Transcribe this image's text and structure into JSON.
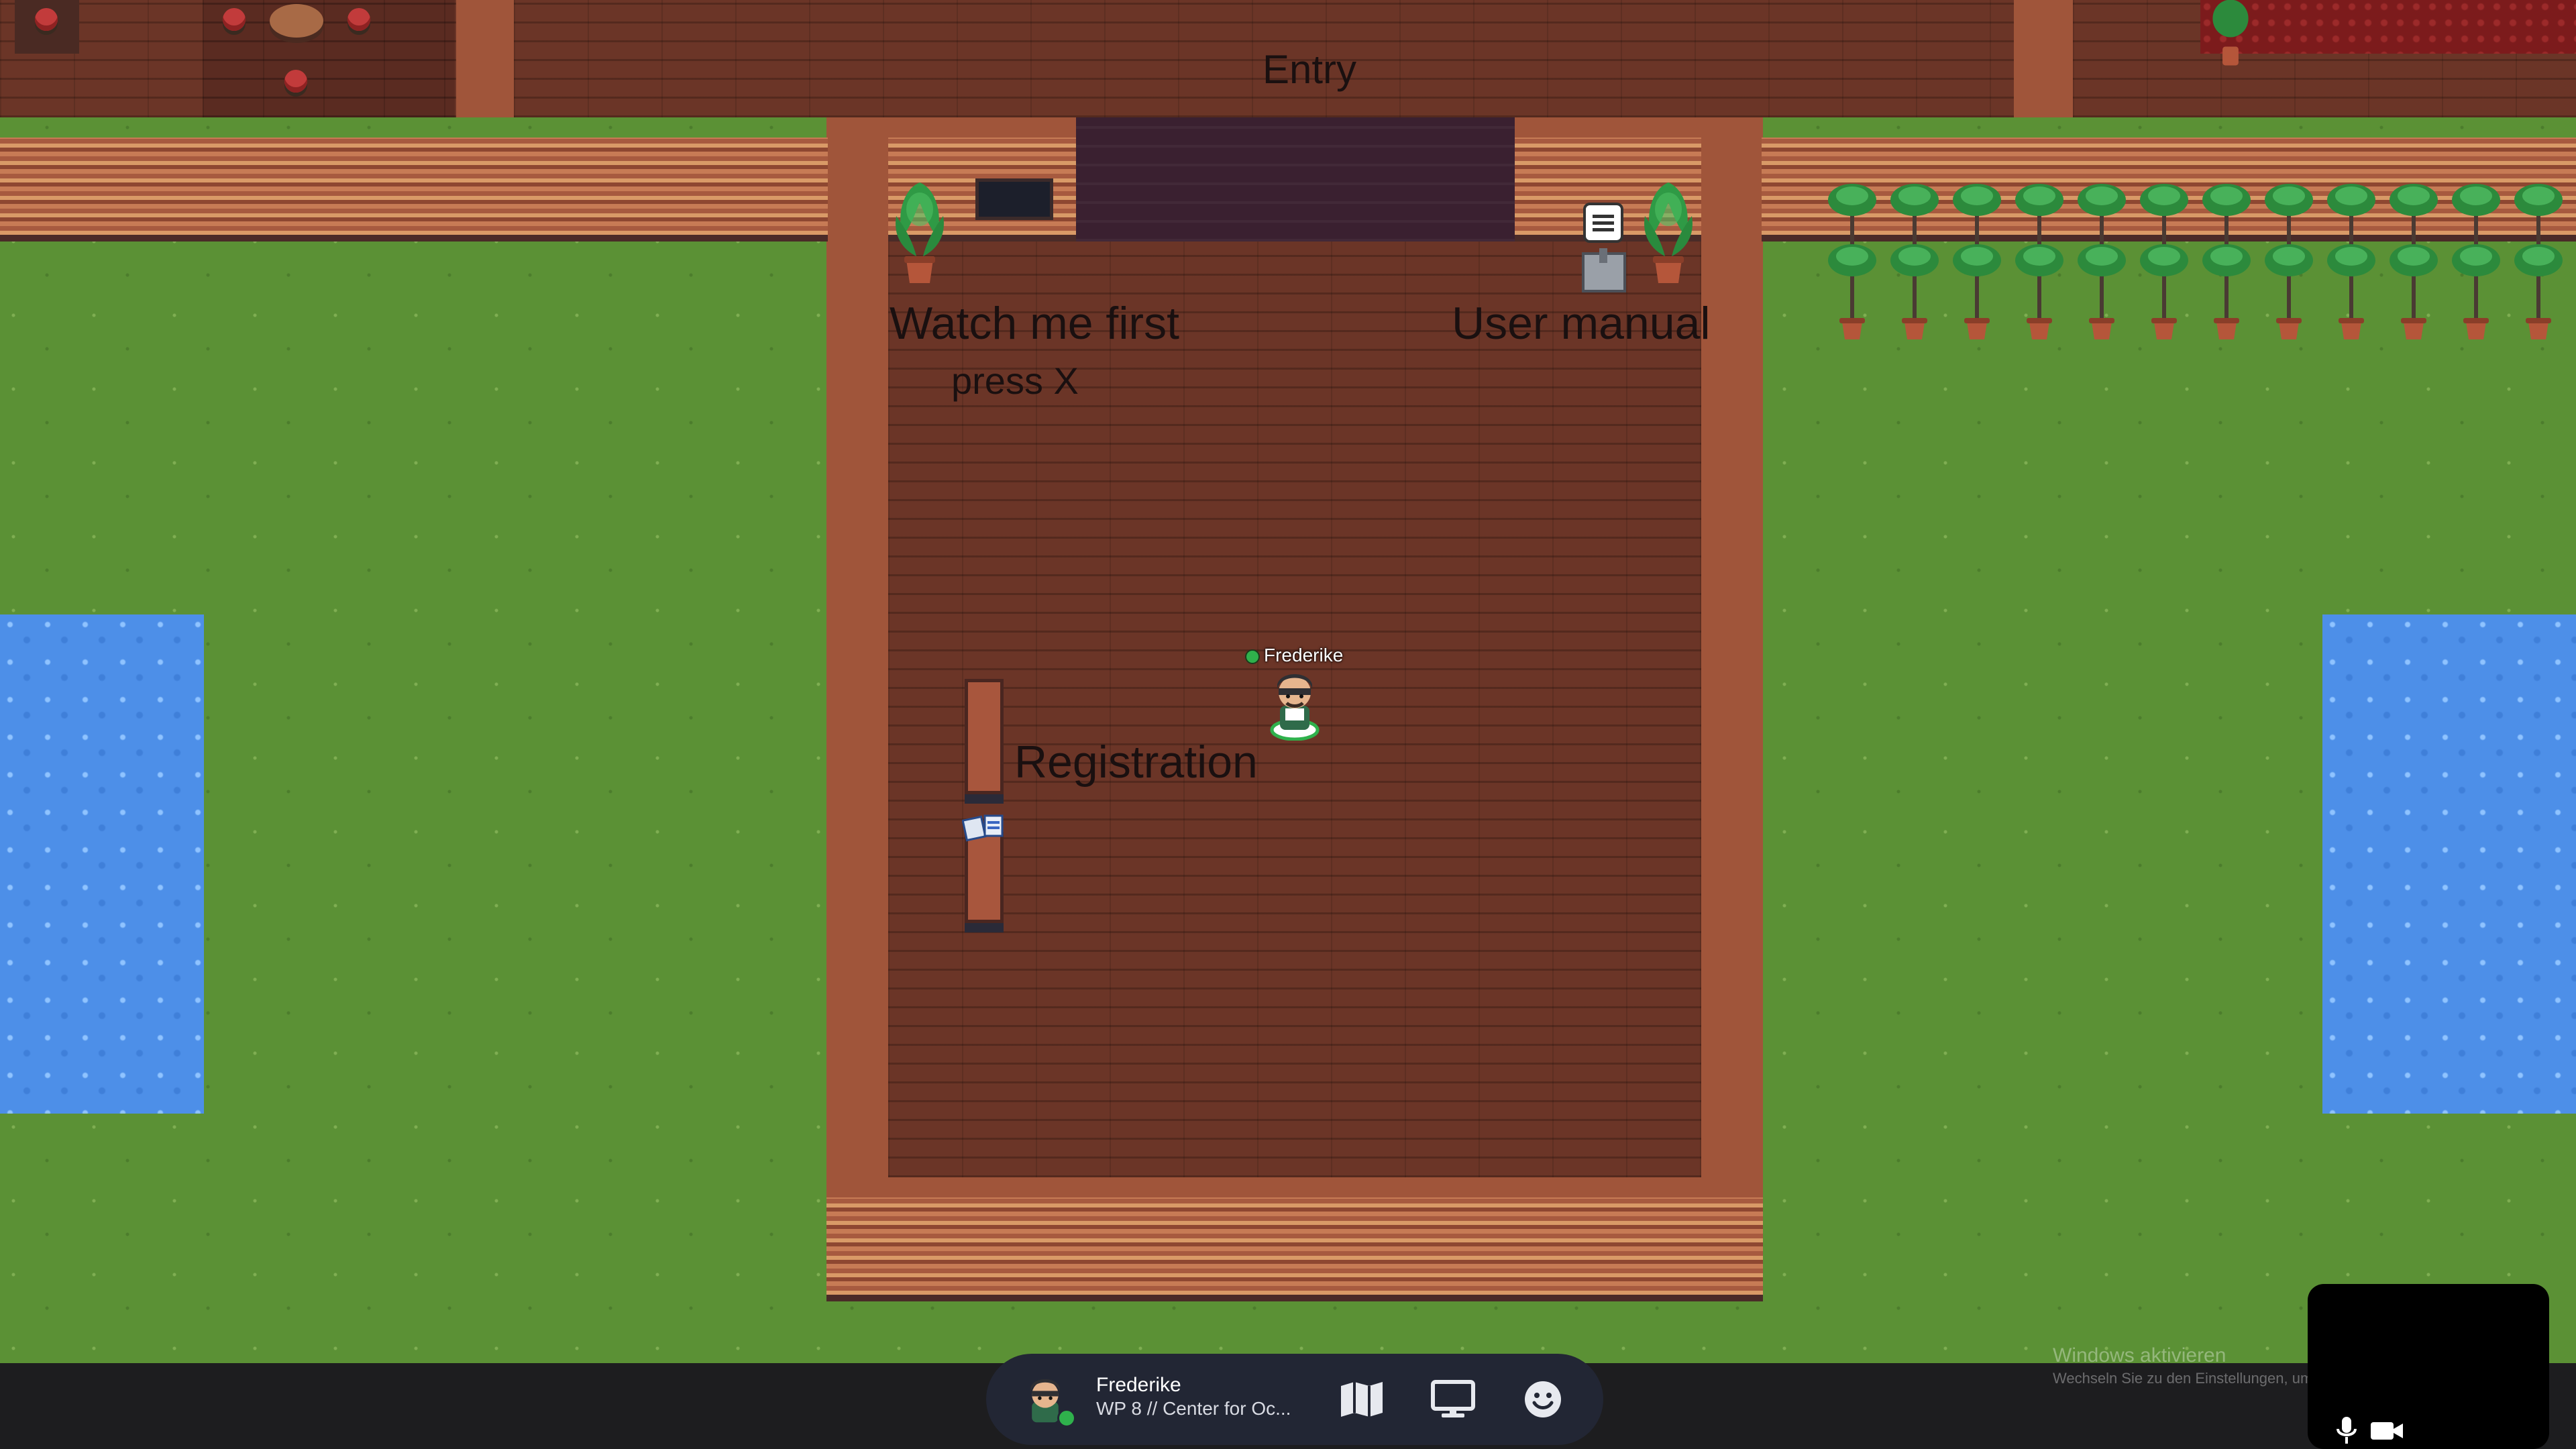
{
  "map": {
    "labels": {
      "entry": "Entry",
      "watch_me_first": "Watch me first",
      "press_x": "press X",
      "user_manual": "User manual",
      "registration": "Registration"
    },
    "player": {
      "name": "Frederike",
      "status_color": "#2fb14c"
    }
  },
  "bottom_bar": {
    "user_name": "Frederike",
    "user_subtitle": "WP 8 // Center for Oc...",
    "buttons": {
      "map": "map-icon",
      "screen_share": "monitor-icon",
      "emote": "smiley-icon"
    },
    "media": {
      "mic": "microphone-icon",
      "camera": "video-camera-icon"
    }
  },
  "watermark": {
    "title": "Windows aktivieren",
    "subtitle": "Wechseln Sie zu den Einstellungen, um Windows zu aktivieren."
  },
  "colors": {
    "grass": "#5b9135",
    "floor": "#6b3527",
    "water": "#4d8fe8",
    "bar": "#1d1d1f",
    "pill": "#222634",
    "online": "#2fb14c"
  }
}
